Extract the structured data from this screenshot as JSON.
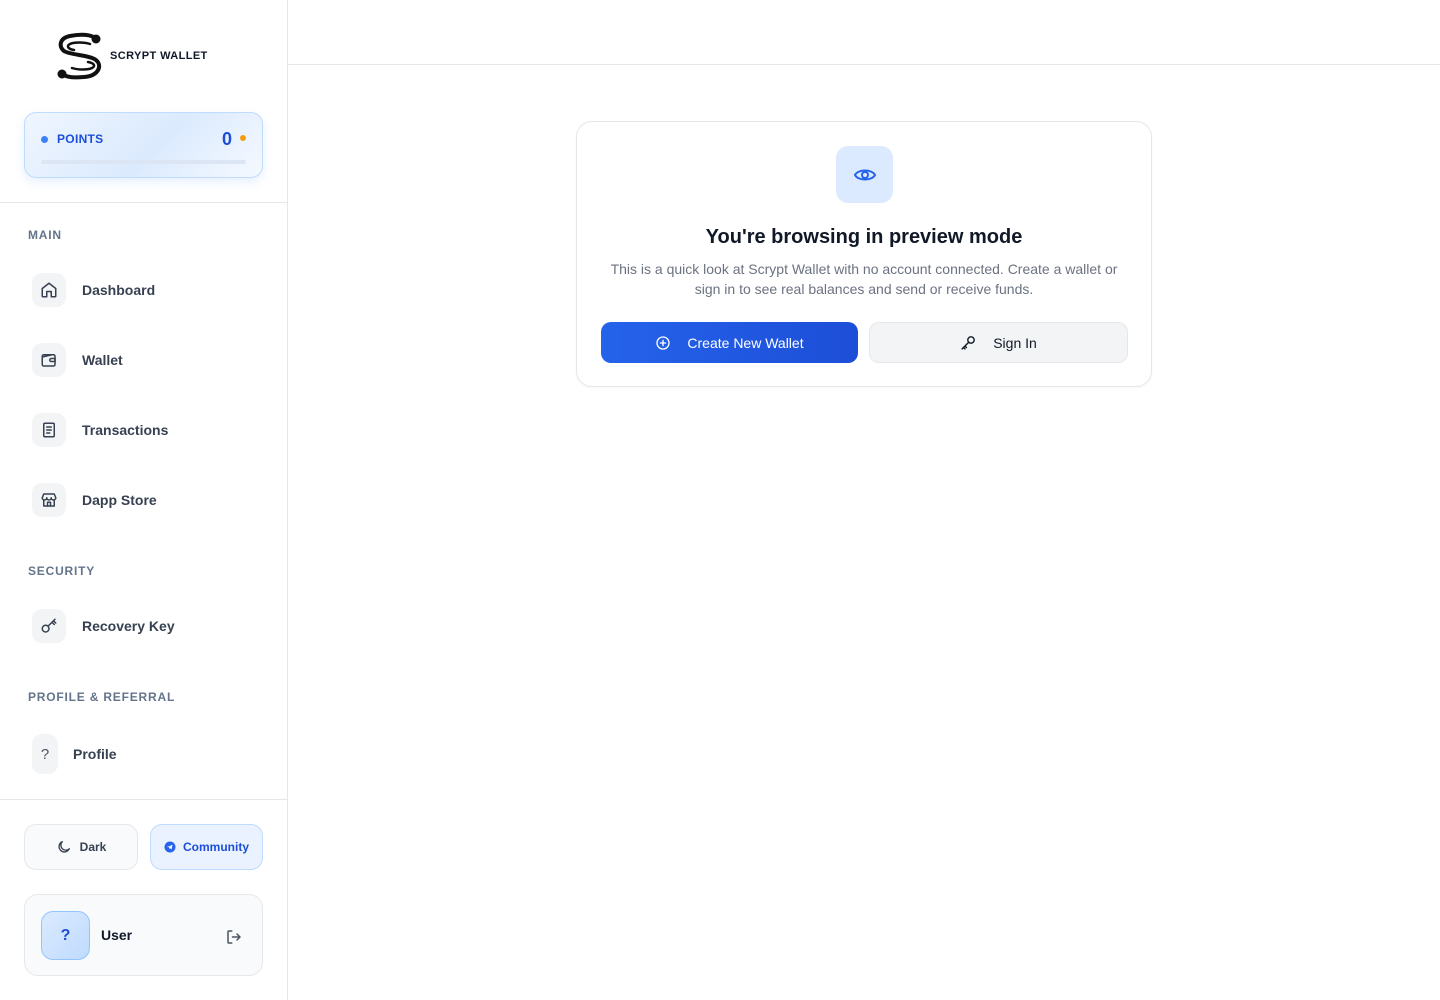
{
  "brand": {
    "name": "SCRYPT WALLET"
  },
  "points": {
    "label": "POINTS",
    "value": "0",
    "progress_percent": 0
  },
  "sidebar": {
    "sections": [
      {
        "title": "MAIN",
        "items": [
          {
            "label": "Dashboard",
            "icon": "home-icon"
          },
          {
            "label": "Wallet",
            "icon": "wallet-icon"
          },
          {
            "label": "Transactions",
            "icon": "receipt-icon"
          },
          {
            "label": "Dapp Store",
            "icon": "store-icon"
          }
        ]
      },
      {
        "title": "SECURITY",
        "items": [
          {
            "label": "Recovery Key",
            "icon": "key-icon"
          }
        ]
      },
      {
        "title": "PROFILE & REFERRAL",
        "items": [
          {
            "label": "Profile",
            "icon": "?"
          }
        ]
      }
    ],
    "theme_toggle": {
      "label": "Dark",
      "icon": "moon-icon"
    },
    "community": {
      "label": "Community",
      "icon": "telegram-icon"
    },
    "user": {
      "avatar": "?",
      "name": "User",
      "logout_icon": "logout-icon"
    }
  },
  "preview": {
    "icon": "eye-icon",
    "title": "You're browsing in preview mode",
    "description": "This is a quick look at Scrypt Wallet with no account connected. Create a wallet or sign in to see real balances and send or receive funds.",
    "create_button": {
      "label": "Create New Wallet",
      "icon": "plus-circle-icon"
    },
    "signin_button": {
      "label": "Sign In",
      "icon": "key-icon"
    }
  },
  "colors": {
    "primary": "#2563eb",
    "accent": "#f59e0b",
    "border": "#e5e7eb"
  }
}
